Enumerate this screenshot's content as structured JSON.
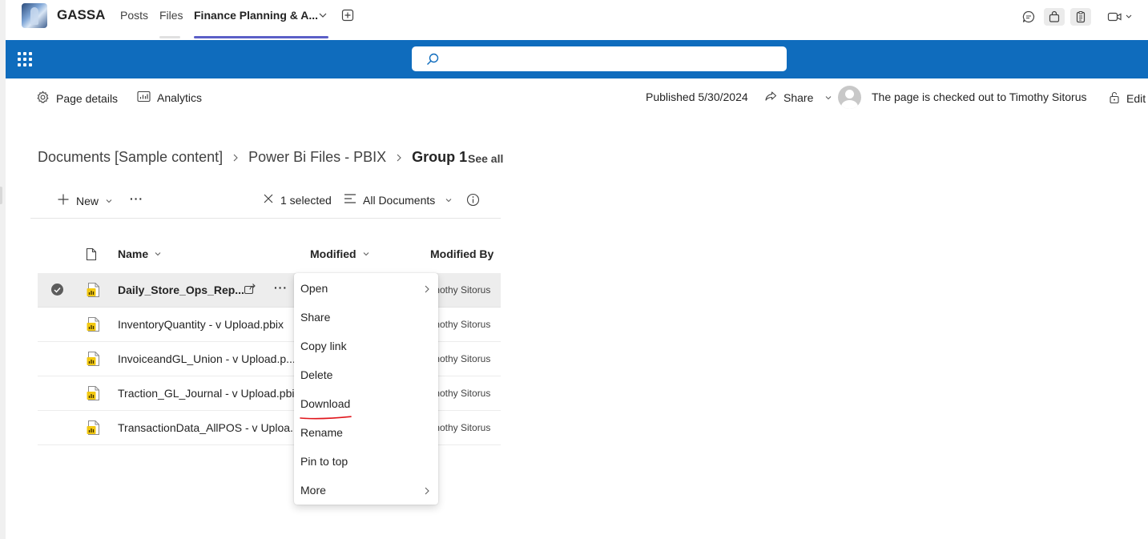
{
  "teams": {
    "team_name": "GASSA",
    "tabs": [
      {
        "label": "Posts"
      },
      {
        "label": "Files"
      },
      {
        "label": "Finance Planning & A..."
      }
    ]
  },
  "suite": {
    "search_placeholder": ""
  },
  "command_bar": {
    "page_details": "Page details",
    "analytics": "Analytics",
    "published": "Published 5/30/2024",
    "share": "Share",
    "checked_out": "The page is checked out to Timothy Sitorus",
    "edit": "Edit"
  },
  "breadcrumb": {
    "items": [
      "Documents [Sample content]",
      "Power Bi Files - PBIX",
      "Group 1"
    ],
    "see_all": "See all"
  },
  "toolbar": {
    "new": "New",
    "more": "···",
    "selected": "1 selected",
    "view": "All Documents"
  },
  "table": {
    "columns": {
      "name": "Name",
      "modified": "Modified",
      "modified_by": "Modified By"
    },
    "rows": [
      {
        "name": "Daily_Store_Ops_Rep...",
        "modified_by": "mothy Sitorus",
        "selected": true
      },
      {
        "name": "InventoryQuantity - v Upload.pbix",
        "modified_by": "mothy Sitorus",
        "selected": false
      },
      {
        "name": "InvoiceandGL_Union - v Upload.p...",
        "modified_by": "mothy Sitorus",
        "selected": false
      },
      {
        "name": "Traction_GL_Journal - v Upload.pbix",
        "modified_by": "mothy Sitorus",
        "selected": false
      },
      {
        "name": "TransactionData_AllPOS - v Uploa...",
        "modified_by": "mothy Sitorus",
        "selected": false
      }
    ]
  },
  "context_menu": {
    "items": [
      {
        "label": "Open",
        "submenu": true
      },
      {
        "label": "Share",
        "submenu": false
      },
      {
        "label": "Copy link",
        "submenu": false
      },
      {
        "label": "Delete",
        "submenu": false
      },
      {
        "label": "Download",
        "submenu": false,
        "annotated": true
      },
      {
        "label": "Rename",
        "submenu": false
      },
      {
        "label": "Pin to top",
        "submenu": false
      },
      {
        "label": "More",
        "submenu": true
      }
    ]
  },
  "colors": {
    "suite_bar": "#0f6cbd",
    "active_tab_underline": "#5b5fc7",
    "pbix_icon": "#f2c811",
    "annotation": "#e0151b"
  }
}
